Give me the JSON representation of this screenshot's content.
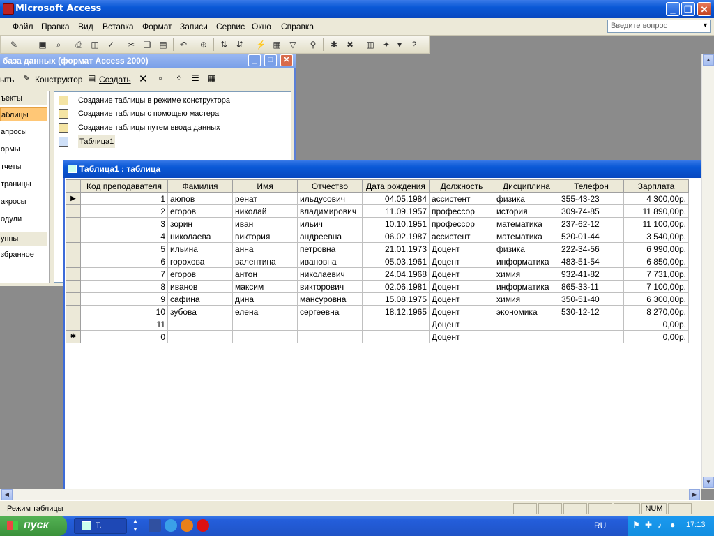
{
  "app": {
    "title": "Microsoft Access"
  },
  "menu": [
    "Файл",
    "Правка",
    "Вид",
    "Вставка",
    "Формат",
    "Записи",
    "Сервис",
    "Окно",
    "Справка"
  ],
  "ask_placeholder": "Введите вопрос",
  "db_window": {
    "title": "база данных (формат Access 2000)",
    "open_label": "ыть",
    "designer_label": "Конструктор",
    "create_label": "Создать",
    "objects_label": "ъекты",
    "objects": [
      "аблицы",
      "апросы",
      "ормы",
      "тчеты",
      "траницы",
      "акросы",
      "одули"
    ],
    "groups_label": "уппы",
    "favorites_label": "збранное",
    "items": [
      "Создание таблицы в режиме конструктора",
      "Создание таблицы с помощью мастера",
      "Создание таблицы путем ввода данных",
      "Таблица1"
    ]
  },
  "table_window": {
    "title": "Таблица1 : таблица",
    "columns": [
      "Код преподавателя",
      "Фамилия",
      "Имя",
      "Отчество",
      "Дата рождения",
      "Должность",
      "Дисциплина",
      "Телефон",
      "Зарплата"
    ],
    "rows": [
      [
        "1",
        "аюпов",
        "ренат",
        "ильдусович",
        "04.05.1984",
        "ассистент",
        "физика",
        "355-43-23",
        "4 300,00р."
      ],
      [
        "2",
        "егоров",
        "николай",
        "владимирович",
        "11.09.1957",
        "профессор",
        "история",
        "309-74-85",
        "11 890,00р."
      ],
      [
        "3",
        "зорин",
        "иван",
        "ильич",
        "10.10.1951",
        "профессор",
        "математика",
        "237-62-12",
        "11 100,00р."
      ],
      [
        "4",
        "николаева",
        "виктория",
        "андреевна",
        "06.02.1987",
        "ассистент",
        "математика",
        "520-01-44",
        "3 540,00р."
      ],
      [
        "5",
        "ильина",
        "анна",
        "петровна",
        "21.01.1973",
        "Доцент",
        "физика",
        "222-34-56",
        "6 990,00р."
      ],
      [
        "6",
        "горохова",
        "валентина",
        "ивановна",
        "05.03.1961",
        "Доцент",
        "информатика",
        "483-51-54",
        "6 850,00р."
      ],
      [
        "7",
        "егоров",
        "антон",
        "николаевич",
        "24.04.1968",
        "Доцент",
        "химия",
        "932-41-82",
        "7 731,00р."
      ],
      [
        "8",
        "иванов",
        "максим",
        "викторович",
        "02.06.1981",
        "Доцент",
        "информатика",
        "865-33-11",
        "7 100,00р."
      ],
      [
        "9",
        "сафина",
        "дина",
        "мансуровна",
        "15.08.1975",
        "Доцент",
        "химия",
        "350-51-40",
        "6 300,00р."
      ],
      [
        "10",
        "зубова",
        "елена",
        "сергеевна",
        "18.12.1965",
        "Доцент",
        "экономика",
        "530-12-12",
        "8 270,00р."
      ],
      [
        "11",
        "",
        "",
        "",
        "",
        "Доцент",
        "",
        "",
        "0,00р."
      ],
      [
        "0",
        "",
        "",
        "",
        "",
        "Доцент",
        "",
        "",
        "0,00р."
      ]
    ]
  },
  "status": {
    "mode": "Режим таблицы",
    "num": "NUM"
  },
  "taskbar": {
    "start": "пуск",
    "task": "Т.",
    "lang": "RU",
    "clock": "17:13"
  }
}
